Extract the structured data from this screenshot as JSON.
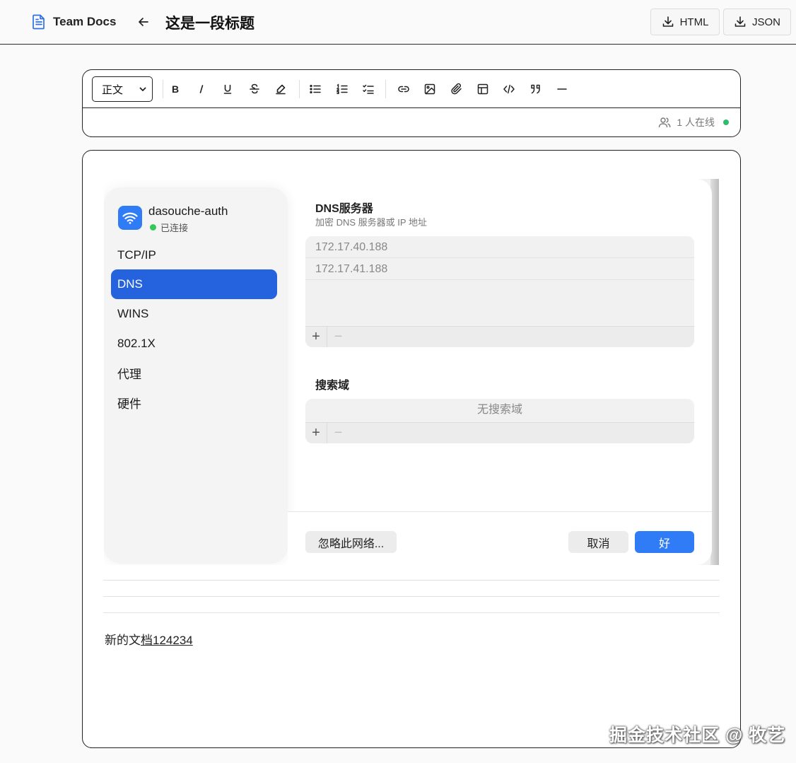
{
  "header": {
    "app_name": "Team Docs",
    "doc_title": "这是一段标题",
    "export_html": "HTML",
    "export_json": "JSON"
  },
  "toolbar": {
    "style_value": "正文",
    "online_text": "1 人在线",
    "buttons": [
      "bold",
      "italic",
      "underline",
      "strikethrough",
      "highlight",
      "bullet-list",
      "ordered-list",
      "task-list",
      "link",
      "image",
      "attachment",
      "table",
      "code",
      "quote",
      "horizontal-rule"
    ]
  },
  "network_dialog": {
    "network_name": "dasouche-auth",
    "status": "已连接",
    "sidebar": [
      "TCP/IP",
      "DNS",
      "WINS",
      "802.1X",
      "代理",
      "硬件"
    ],
    "active_item": "DNS",
    "dns_title": "DNS服务器",
    "dns_subtitle": "加密 DNS 服务器或 IP 地址",
    "dns_servers": [
      "172.17.40.188",
      "172.17.41.188"
    ],
    "search_title": "搜索域",
    "search_empty": "无搜索域",
    "plus": "+",
    "minus": "−",
    "ignore_btn": "忽略此网络...",
    "cancel_btn": "取消",
    "ok_btn": "好"
  },
  "document": {
    "text_plain": "新的文",
    "text_underlined": "档124234"
  },
  "watermark": "掘金技术社区 @ 牧艺",
  "colors": {
    "accent": "#2563de",
    "online": "#2ebd6b",
    "brand_icon": "#2f6fe0"
  }
}
